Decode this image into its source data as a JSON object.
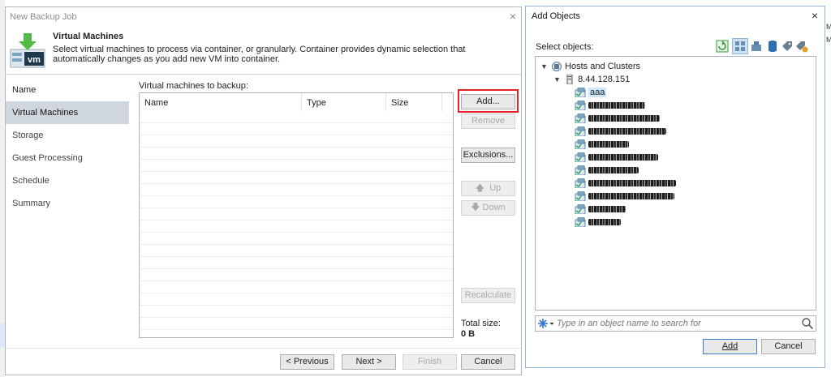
{
  "wizard": {
    "title": "New Backup Job",
    "close": "×",
    "heading": "Virtual Machines",
    "description": "Select virtual machines to process via container, or granularly. Container provides dynamic selection that automatically changes as you add new VM into container.",
    "icon_text": "vm",
    "nav": [
      "Name",
      "Virtual Machines",
      "Storage",
      "Guest Processing",
      "Schedule",
      "Summary"
    ],
    "active_nav": 1,
    "list_label": "Virtual machines to backup:",
    "columns": [
      "Name",
      "Type",
      "Size"
    ],
    "buttons": {
      "add": "Add...",
      "remove": "Remove",
      "exclusions": "Exclusions...",
      "up": "Up",
      "down": "Down",
      "recalculate": "Recalculate"
    },
    "total_label": "Total size:",
    "total_value": "0 B",
    "footer": {
      "previous": "< Previous",
      "next": "Next >",
      "finish": "Finish",
      "cancel": "Cancel"
    }
  },
  "add_objects": {
    "title": "Add Objects",
    "close": "×",
    "select_label": "Select objects:",
    "toolbar_icons": [
      "refresh-icon",
      "hosts-view-icon",
      "vms-and-templates-icon",
      "datastores-icon",
      "tags-icon",
      "tag-filter-icon"
    ],
    "tree": {
      "root": "Hosts and Clusters",
      "host": "8.44.128.151",
      "selected_vm": "aaa",
      "obscured_vm_widths": [
        70,
        88,
        96,
        50,
        86,
        62,
        108,
        106,
        46,
        40
      ]
    },
    "search_placeholder": "Type in an object name to search for",
    "buttons": {
      "add": "Add",
      "cancel": "Cancel"
    }
  },
  "edge": {
    "letters": [
      "M",
      "M"
    ]
  },
  "colors": {
    "highlight": "#e0232b",
    "selection": "#cde8ff",
    "nav_active": "#cfd6dd"
  }
}
